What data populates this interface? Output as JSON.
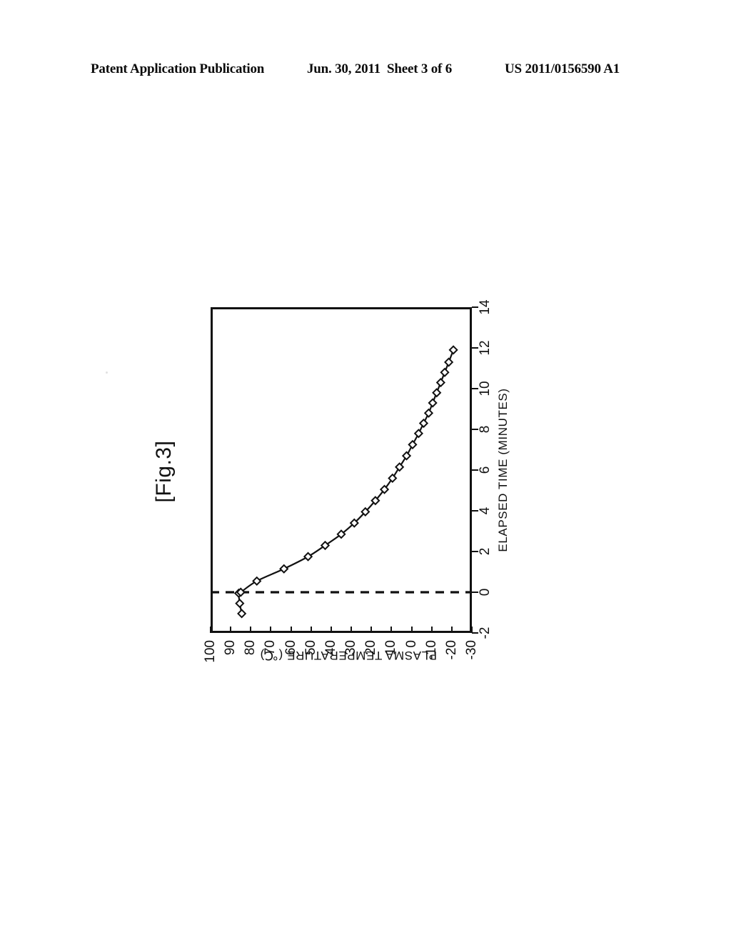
{
  "header": {
    "publication_label": "Patent Application Publication",
    "date": "Jun. 30, 2011",
    "sheet": "Sheet 3 of 6",
    "publication_number": "US 2011/0156590 A1"
  },
  "figure": {
    "label": "[Fig.3]",
    "rotation": "90-deg-counter-clockwise"
  },
  "chart_data": {
    "type": "line",
    "title": "",
    "subtitle": "",
    "xlabel": "ELAPSED TIME (MINUTES)",
    "ylabel": "PLASMA TEMPERATURE (℃)",
    "xlim": [
      -2,
      14
    ],
    "ylim": [
      -30,
      100
    ],
    "xticks": [
      -2,
      0,
      2,
      4,
      6,
      8,
      10,
      12,
      14
    ],
    "xtick_labels": [
      "-2",
      "0",
      "2",
      "4",
      "6",
      "8",
      "10",
      "12",
      "14"
    ],
    "yticks": [
      100,
      90,
      80,
      70,
      60,
      50,
      40,
      30,
      20,
      10,
      0,
      -10,
      -20,
      -30
    ],
    "ytick_labels": [
      "100",
      "90",
      "80",
      "70",
      "60",
      "50",
      "40",
      "30",
      "20",
      "10",
      "0",
      "-10",
      "-20",
      "-30"
    ],
    "grid": false,
    "legend": false,
    "legend_position": "none",
    "marker": "open-diamond",
    "annotations": [
      {
        "name": "zero-time-reference-line",
        "style": "dashed",
        "orientation": "vertical",
        "x": 0
      }
    ],
    "series": [
      {
        "name": "Plasma temperature",
        "x": [
          -1.05,
          -0.55,
          -0.05,
          0.0,
          0.55,
          1.15,
          1.75,
          2.3,
          2.85,
          3.4,
          3.95,
          4.5,
          5.05,
          5.6,
          6.15,
          6.7,
          7.25,
          7.8,
          8.3,
          8.8,
          9.3,
          9.8,
          10.3,
          10.8,
          11.3,
          11.9
        ],
        "y": [
          84.5,
          85.5,
          86.0,
          85.0,
          77.0,
          63.5,
          51.5,
          43.0,
          35.0,
          28.5,
          23.0,
          18.0,
          13.5,
          9.5,
          6.0,
          2.5,
          -0.5,
          -3.5,
          -6.0,
          -8.5,
          -10.5,
          -12.5,
          -14.5,
          -16.5,
          -18.5,
          -20.8
        ]
      }
    ]
  }
}
